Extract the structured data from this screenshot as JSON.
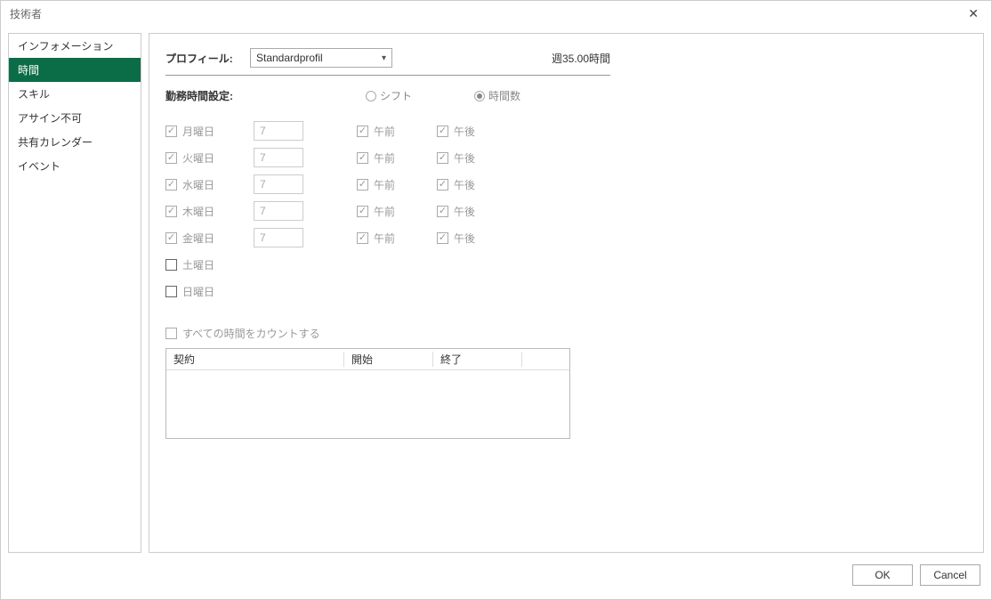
{
  "title": "技術者",
  "sidebar": {
    "items": [
      {
        "label": "インフォメーション",
        "active": false
      },
      {
        "label": "時間",
        "active": true
      },
      {
        "label": "スキル",
        "active": false
      },
      {
        "label": "アサイン不可",
        "active": false
      },
      {
        "label": "共有カレンダー",
        "active": false
      },
      {
        "label": "イベント",
        "active": false
      }
    ]
  },
  "profile": {
    "label": "プロフィール:",
    "value": "Standardprofil",
    "weekly": "週35.00時間"
  },
  "workSetting": {
    "label": "勤務時間設定:",
    "options": [
      "シフト",
      "時間数"
    ],
    "selected": 1
  },
  "days": [
    {
      "name": "月曜日",
      "checked": true,
      "hours": "7",
      "amChecked": true,
      "pmChecked": true
    },
    {
      "name": "火曜日",
      "checked": true,
      "hours": "7",
      "amChecked": true,
      "pmChecked": true
    },
    {
      "name": "水曜日",
      "checked": true,
      "hours": "7",
      "amChecked": true,
      "pmChecked": true
    },
    {
      "name": "木曜日",
      "checked": true,
      "hours": "7",
      "amChecked": true,
      "pmChecked": true
    },
    {
      "name": "金曜日",
      "checked": true,
      "hours": "7",
      "amChecked": true,
      "pmChecked": true
    },
    {
      "name": "土曜日",
      "checked": false
    },
    {
      "name": "日曜日",
      "checked": false
    }
  ],
  "slotLabels": {
    "am": "午前",
    "pm": "午後"
  },
  "countAll": {
    "label": "すべての時間をカウントする",
    "checked": false
  },
  "table": {
    "headers": [
      "契約",
      "開始",
      "終了",
      ""
    ]
  },
  "buttons": {
    "ok": "OK",
    "cancel": "Cancel"
  }
}
